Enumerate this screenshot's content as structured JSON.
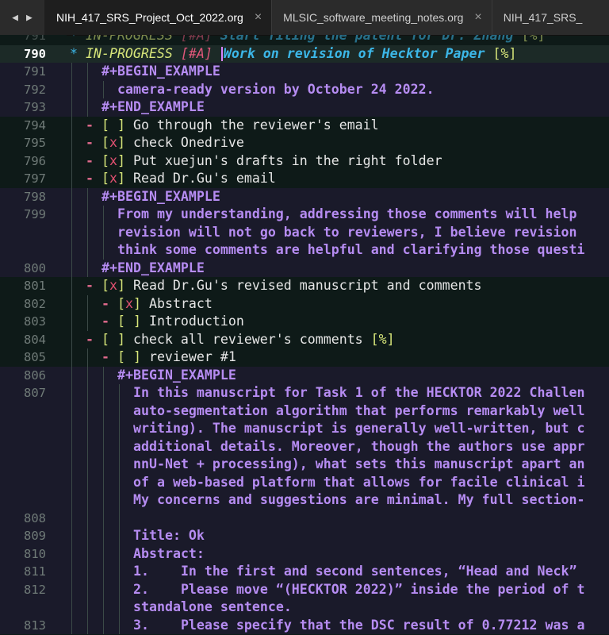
{
  "nav": {
    "back": "◀",
    "forward": "▶"
  },
  "tabs": [
    {
      "label": "NIH_417_SRS_Project_Oct_2022.org",
      "close": "×"
    },
    {
      "label": "MLSIC_software_meeting_notes.org",
      "close": "×"
    },
    {
      "label": "NIH_417_SRS_",
      "close": ""
    }
  ],
  "lines": [
    {
      "n": "791",
      "parts": [
        [
          "star",
          "* "
        ],
        [
          "todo",
          "IN-PROGRESS "
        ],
        [
          "prio",
          "[#A] "
        ],
        [
          "heading",
          "Start filing the patent for Dr. Zhang "
        ],
        [
          "pct",
          "[%]"
        ]
      ],
      "indent": 0,
      "dim": true
    },
    {
      "n": "790",
      "cur": true,
      "parts": [
        [
          "star",
          "* "
        ],
        [
          "todo",
          "IN-PROGRESS "
        ],
        [
          "prio",
          "[#A] "
        ],
        [
          "heading",
          "Work on revision of Hecktor Paper "
        ],
        [
          "pct",
          "[%]"
        ]
      ],
      "indent": 0
    },
    {
      "n": "791",
      "parts": [
        [
          "kw",
          "#+BEGIN_EXAMPLE"
        ]
      ],
      "indent": 2,
      "block": true
    },
    {
      "n": "792",
      "parts": [
        [
          "ex",
          "camera-ready version by October 24 2022."
        ]
      ],
      "indent": 3,
      "block": true
    },
    {
      "n": "793",
      "parts": [
        [
          "kw",
          "#+END_EXAMPLE"
        ]
      ],
      "indent": 2,
      "block": true
    },
    {
      "n": "794",
      "parts": [
        [
          "bullet",
          "- "
        ],
        [
          "cb",
          "[ ] "
        ],
        [
          "txt",
          "Go through the reviewer's email"
        ]
      ],
      "indent": 1
    },
    {
      "n": "795",
      "parts": [
        [
          "bullet",
          "- "
        ],
        [
          "cb",
          "["
        ],
        [
          "cbx",
          "x"
        ],
        [
          "cb",
          "] "
        ],
        [
          "txt",
          "check Onedrive"
        ]
      ],
      "indent": 1
    },
    {
      "n": "796",
      "parts": [
        [
          "bullet",
          "- "
        ],
        [
          "cb",
          "["
        ],
        [
          "cbx",
          "x"
        ],
        [
          "cb",
          "] "
        ],
        [
          "txt",
          "Put xuejun's drafts in the right folder"
        ]
      ],
      "indent": 1
    },
    {
      "n": "797",
      "parts": [
        [
          "bullet",
          "- "
        ],
        [
          "cb",
          "["
        ],
        [
          "cbx",
          "x"
        ],
        [
          "cb",
          "] "
        ],
        [
          "txt",
          "Read Dr.Gu's email"
        ]
      ],
      "indent": 1
    },
    {
      "n": "798",
      "parts": [
        [
          "kw",
          "#+BEGIN_EXAMPLE"
        ]
      ],
      "indent": 2,
      "block": true
    },
    {
      "n": "799",
      "parts": [
        [
          "ex",
          "From my understanding, addressing those comments will help"
        ]
      ],
      "indent": 3,
      "block": true
    },
    {
      "n": "",
      "parts": [
        [
          "ex",
          "revision will not go back to reviewers, I believe revision"
        ]
      ],
      "indent": 3,
      "block": true
    },
    {
      "n": "",
      "parts": [
        [
          "ex",
          "think some comments are helpful and clarifying those questi"
        ]
      ],
      "indent": 3,
      "block": true
    },
    {
      "n": "800",
      "parts": [
        [
          "kw",
          "#+END_EXAMPLE"
        ]
      ],
      "indent": 2,
      "block": true
    },
    {
      "n": "801",
      "parts": [
        [
          "bullet",
          "- "
        ],
        [
          "cb",
          "["
        ],
        [
          "cbx",
          "x"
        ],
        [
          "cb",
          "] "
        ],
        [
          "txt",
          "Read Dr.Gu's revised manuscript and comments"
        ]
      ],
      "indent": 1
    },
    {
      "n": "802",
      "parts": [
        [
          "bullet",
          "- "
        ],
        [
          "cb",
          "["
        ],
        [
          "cbx",
          "x"
        ],
        [
          "cb",
          "] "
        ],
        [
          "txt",
          "Abstract"
        ]
      ],
      "indent": 2
    },
    {
      "n": "803",
      "parts": [
        [
          "bullet",
          "- "
        ],
        [
          "cb",
          "[ ] "
        ],
        [
          "txt",
          "Introduction"
        ]
      ],
      "indent": 2
    },
    {
      "n": "804",
      "parts": [
        [
          "bullet",
          "- "
        ],
        [
          "cb",
          "[ ] "
        ],
        [
          "txt",
          "check all reviewer's comments "
        ],
        [
          "pct",
          "[%]"
        ]
      ],
      "indent": 1
    },
    {
      "n": "805",
      "parts": [
        [
          "bullet",
          "- "
        ],
        [
          "cb",
          "[ ] "
        ],
        [
          "txt",
          "reviewer #1"
        ]
      ],
      "indent": 2
    },
    {
      "n": "806",
      "parts": [
        [
          "kw",
          "#+BEGIN_EXAMPLE"
        ]
      ],
      "indent": 3,
      "block": true
    },
    {
      "n": "807",
      "parts": [
        [
          "ex",
          "In this manuscript for Task 1 of the HECKTOR 2022 Challen"
        ]
      ],
      "indent": 4,
      "block": true
    },
    {
      "n": "",
      "parts": [
        [
          "ex",
          "auto-segmentation algorithm that performs remarkably well"
        ]
      ],
      "indent": 4,
      "block": true
    },
    {
      "n": "",
      "parts": [
        [
          "ex",
          "writing). The manuscript is generally well-written, but c"
        ]
      ],
      "indent": 4,
      "block": true
    },
    {
      "n": "",
      "parts": [
        [
          "ex",
          "additional details. Moreover, though the authors use appr"
        ]
      ],
      "indent": 4,
      "block": true
    },
    {
      "n": "",
      "parts": [
        [
          "ex",
          "nnU-Net + processing), what sets this manuscript apart an"
        ]
      ],
      "indent": 4,
      "block": true
    },
    {
      "n": "",
      "parts": [
        [
          "ex",
          "of a web-based platform that allows for facile clinical i"
        ]
      ],
      "indent": 4,
      "block": true
    },
    {
      "n": "",
      "parts": [
        [
          "ex",
          "My concerns and suggestions are minimal. My full section-"
        ]
      ],
      "indent": 4,
      "block": true
    },
    {
      "n": "808",
      "parts": [],
      "indent": 4,
      "block": true
    },
    {
      "n": "809",
      "parts": [
        [
          "ex",
          "Title: Ok"
        ]
      ],
      "indent": 4,
      "block": true
    },
    {
      "n": "810",
      "parts": [
        [
          "ex",
          "Abstract:"
        ]
      ],
      "indent": 4,
      "block": true
    },
    {
      "n": "811",
      "parts": [
        [
          "ex",
          "1.    In the first and second sentences, “Head and Neck”"
        ]
      ],
      "indent": 4,
      "block": true
    },
    {
      "n": "812",
      "parts": [
        [
          "ex",
          "2.    Please move “(HECKTOR 2022)” inside the period of t"
        ]
      ],
      "indent": 4,
      "block": true
    },
    {
      "n": "",
      "parts": [
        [
          "ex",
          "standalone sentence."
        ]
      ],
      "indent": 4,
      "block": true
    },
    {
      "n": "813",
      "parts": [
        [
          "ex",
          "3.    Please specify that the DSC result of 0.77212 was a"
        ]
      ],
      "indent": 4,
      "block": true
    }
  ]
}
